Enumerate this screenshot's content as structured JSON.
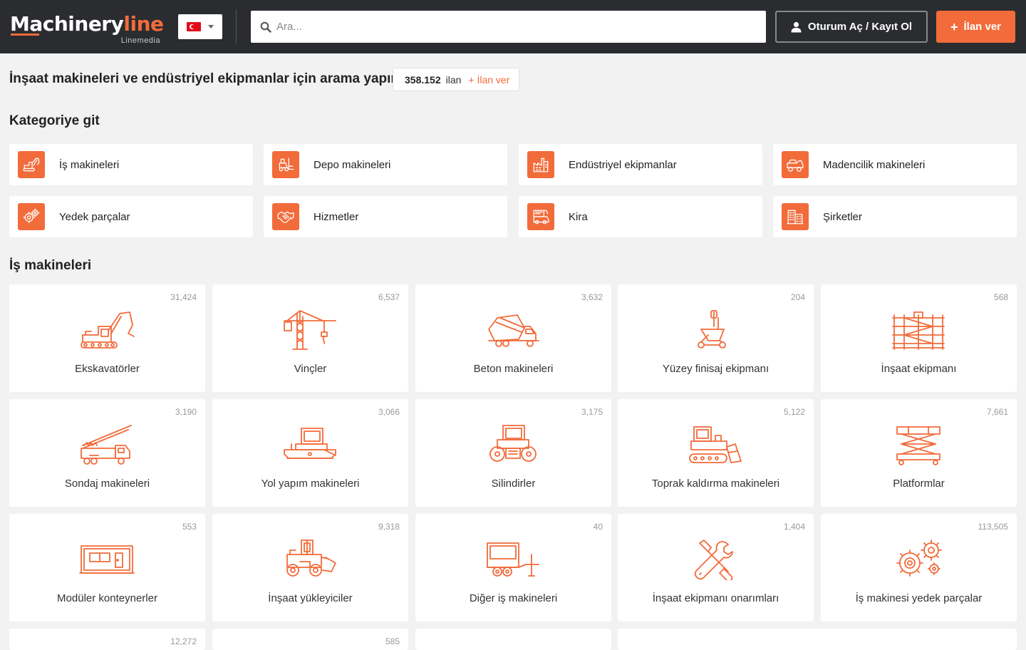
{
  "header": {
    "logo": {
      "main": "Machinery",
      "accent": "line",
      "sub": "Linemedia"
    },
    "language": {
      "selected": "TR"
    },
    "search": {
      "placeholder": "Ara..."
    },
    "login_label": "Oturum Aç / Kayıt Ol",
    "post_ad_label": "İlan ver"
  },
  "intro": {
    "title": "İnşaat makineleri ve endüstriyel ekipmanlar için arama yapın",
    "listing_count": "358.152",
    "listing_label": "ilan",
    "post_link": "+ İlan ver"
  },
  "categories_section": {
    "title": "Kategoriye git",
    "items": [
      {
        "label": "İş makineleri",
        "icon": "excavator-icon"
      },
      {
        "label": "Depo makineleri",
        "icon": "forklift-icon"
      },
      {
        "label": "Endüstriyel ekipmanlar",
        "icon": "factory-icon"
      },
      {
        "label": "Madencilik makineleri",
        "icon": "mining-truck-icon"
      },
      {
        "label": "Yedek parçalar",
        "icon": "gears-icon"
      },
      {
        "label": "Hizmetler",
        "icon": "handshake-icon"
      },
      {
        "label": "Kira",
        "icon": "rent-icon"
      },
      {
        "label": "Şirketler",
        "icon": "buildings-icon"
      }
    ]
  },
  "machinery_section": {
    "title": "İş makineleri",
    "tiles": [
      {
        "label": "Ekskavatörler",
        "count": "31,424",
        "icon": "excavator-icon"
      },
      {
        "label": "Vinçler",
        "count": "6,537",
        "icon": "crane-icon"
      },
      {
        "label": "Beton makineleri",
        "count": "3,632",
        "icon": "concrete-mixer-icon"
      },
      {
        "label": "Yüzey finisaj ekipmanı",
        "count": "204",
        "icon": "surface-finisher-icon"
      },
      {
        "label": "İnşaat ekipmanı",
        "count": "568",
        "icon": "scaffolding-icon"
      },
      {
        "label": "Sondaj makineleri",
        "count": "3,190",
        "icon": "drilling-rig-icon"
      },
      {
        "label": "Yol yapım makineleri",
        "count": "3,066",
        "icon": "paver-icon"
      },
      {
        "label": "Silindirler",
        "count": "3,175",
        "icon": "roller-icon"
      },
      {
        "label": "Toprak kaldırma makineleri",
        "count": "5,122",
        "icon": "bulldozer-icon"
      },
      {
        "label": "Platformlar",
        "count": "7,661",
        "icon": "scissor-lift-icon"
      },
      {
        "label": "Modüler konteynerler",
        "count": "553",
        "icon": "container-icon"
      },
      {
        "label": "İnşaat yükleyiciler",
        "count": "9,318",
        "icon": "wheel-loader-icon"
      },
      {
        "label": "Diğer iş makineleri",
        "count": "40",
        "icon": "trailer-icon"
      },
      {
        "label": "İnşaat ekipmanı onarımları",
        "count": "1,404",
        "icon": "wrench-screwdriver-icon"
      },
      {
        "label": "İş makinesi yedek parçalar",
        "count": "113,505",
        "icon": "gears-icon"
      },
      {
        "label": "",
        "count": "12,272",
        "icon": ""
      },
      {
        "label": "",
        "count": "585",
        "icon": ""
      }
    ]
  },
  "colors": {
    "accent": "#f26b3a",
    "header_bg": "#2a2c30",
    "page_bg": "#f2f2f2"
  }
}
